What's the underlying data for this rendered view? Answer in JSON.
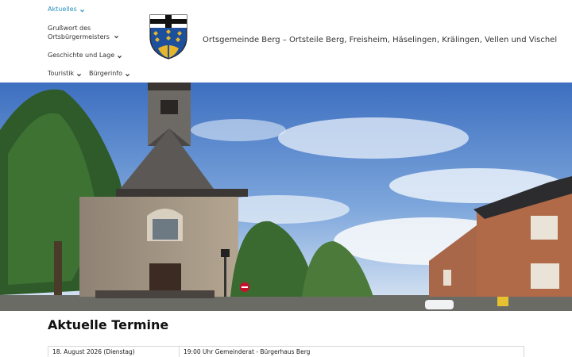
{
  "nav": {
    "items": [
      {
        "label": "Aktuelles",
        "active": true
      },
      {
        "label": "Grußwort des Ortsbürgermeisters",
        "active": false
      },
      {
        "label": "Geschichte und Lage",
        "active": false
      },
      {
        "label": "Touristik",
        "active": false
      },
      {
        "label": "Bürgerinfo",
        "active": false
      }
    ]
  },
  "header": {
    "site_title": "Ortsgemeinde Berg – Ortsteile Berg, Freisheim, Häselingen, Krälingen, Vellen und Vischel",
    "crest_icon": "coat-of-arms-icon"
  },
  "hero": {
    "icon": "church-photo"
  },
  "main": {
    "heading": "Aktuelle Termine",
    "events": [
      {
        "date": "18. August 2026 (Dienstag)",
        "description": "19:00 Uhr Gemeinderat - Bürgerhaus Berg"
      }
    ]
  },
  "colors": {
    "accent": "#2a8fbd",
    "crest_blue": "#1c4f9c",
    "crest_gold": "#e6b52b"
  }
}
